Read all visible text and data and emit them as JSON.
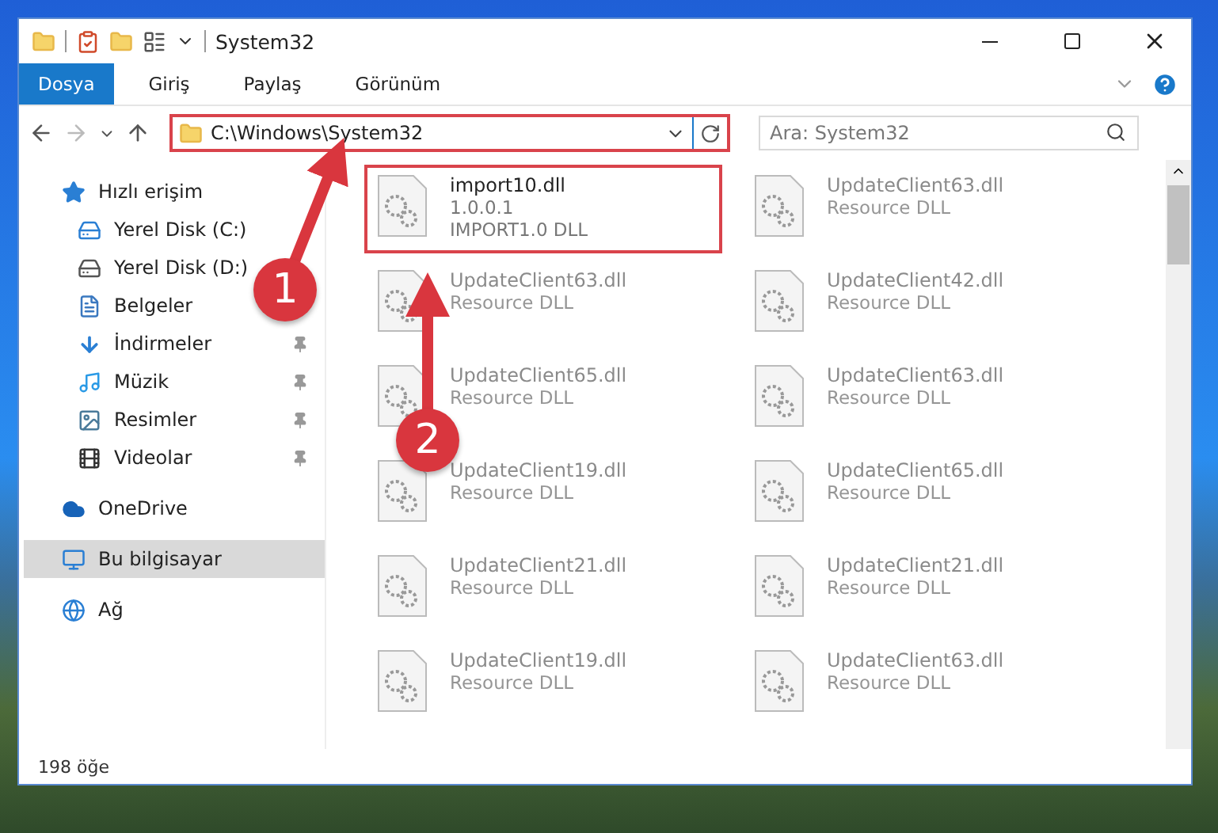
{
  "window": {
    "title": "System32"
  },
  "ribbon": {
    "tabs": [
      {
        "label": "Dosya",
        "kind": "file"
      },
      {
        "label": "Giriş",
        "kind": "tab"
      },
      {
        "label": "Paylaş",
        "kind": "tab"
      },
      {
        "label": "Görünüm",
        "kind": "tab"
      }
    ]
  },
  "address_bar": {
    "path": "C:\\Windows\\System32",
    "highlighted": true
  },
  "search": {
    "placeholder": "Ara: System32"
  },
  "sidebar": {
    "items": [
      {
        "label": "Hızlı erişim",
        "selected": false,
        "children": [
          {
            "label": "Yerel Disk (C:)",
            "pinned": false
          },
          {
            "label": "Yerel Disk (D:)",
            "pinned": false
          },
          {
            "label": "Belgeler",
            "pinned": false
          },
          {
            "label": "İndirmeler",
            "pinned": true
          },
          {
            "label": "Müzik",
            "pinned": true
          },
          {
            "label": "Resimler",
            "pinned": true
          },
          {
            "label": "Videolar",
            "pinned": true
          }
        ]
      },
      {
        "label": "OneDrive",
        "selected": false
      },
      {
        "label": "Bu bilgisayar",
        "selected": true
      },
      {
        "label": "Ağ",
        "selected": false
      }
    ]
  },
  "files": [
    {
      "name": "import10.dll",
      "details": [
        "1.0.0.1",
        "IMPORT1.0 DLL"
      ],
      "highlighted": true,
      "faded": false
    },
    {
      "name": "UpdateClient63.dll",
      "details": [
        "Resource DLL"
      ],
      "highlighted": false,
      "faded": true
    },
    {
      "name": "UpdateClient63.dll",
      "details": [
        "Resource DLL"
      ],
      "highlighted": false,
      "faded": true
    },
    {
      "name": "UpdateClient42.dll",
      "details": [
        "Resource DLL"
      ],
      "highlighted": false,
      "faded": true
    },
    {
      "name": "UpdateClient65.dll",
      "details": [
        "Resource DLL"
      ],
      "highlighted": false,
      "faded": true
    },
    {
      "name": "UpdateClient63.dll",
      "details": [
        "Resource DLL"
      ],
      "highlighted": false,
      "faded": true
    },
    {
      "name": "UpdateClient19.dll",
      "details": [
        "Resource DLL"
      ],
      "highlighted": false,
      "faded": true
    },
    {
      "name": "UpdateClient65.dll",
      "details": [
        "Resource DLL"
      ],
      "highlighted": false,
      "faded": true
    },
    {
      "name": "UpdateClient21.dll",
      "details": [
        "Resource DLL"
      ],
      "highlighted": false,
      "faded": true
    },
    {
      "name": "UpdateClient21.dll",
      "details": [
        "Resource DLL"
      ],
      "highlighted": false,
      "faded": true
    },
    {
      "name": "UpdateClient19.dll",
      "details": [
        "Resource DLL"
      ],
      "highlighted": false,
      "faded": true
    },
    {
      "name": "UpdateClient63.dll",
      "details": [
        "Resource DLL"
      ],
      "highlighted": false,
      "faded": true
    }
  ],
  "status_bar": {
    "count": "198 öğe"
  },
  "annotations": [
    {
      "number": "1"
    },
    {
      "number": "2"
    }
  ]
}
